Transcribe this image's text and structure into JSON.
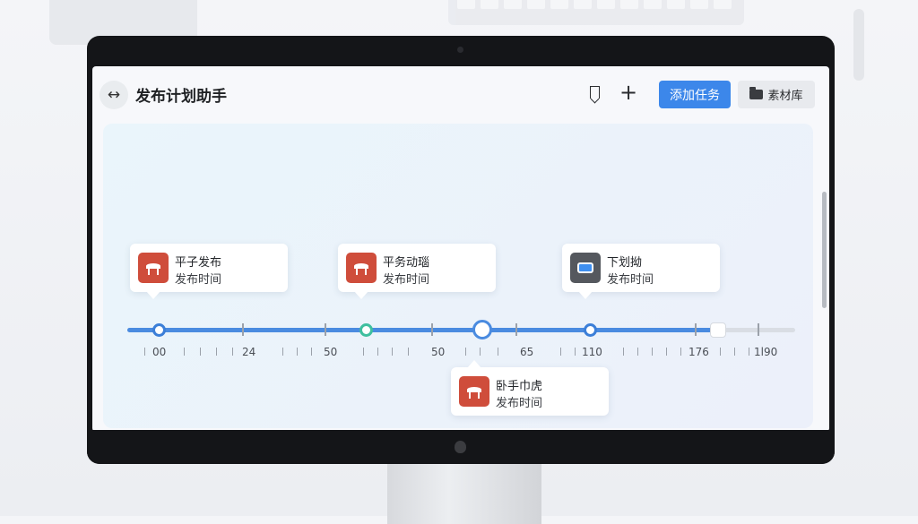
{
  "app": {
    "title": "发布计划助手"
  },
  "header": {
    "add_task_label": "添加任务",
    "library_label": "素材库",
    "plus_label": "+",
    "back_label": "↔"
  },
  "timeline": {
    "tick_labels": [
      "00",
      "24",
      "50",
      "50",
      "65",
      "110",
      "176",
      "1l90"
    ]
  },
  "cards": [
    {
      "title": "平子发布",
      "subtitle": "发布时间",
      "icon": "app-icon-red"
    },
    {
      "title": "平务动瑙",
      "subtitle": "发布时间",
      "icon": "app-icon-red"
    },
    {
      "title": "下划拗",
      "subtitle": "发布时间",
      "icon": "camera-app-icon"
    },
    {
      "title": "卧手巾虎",
      "subtitle": "发布时间",
      "icon": "app-icon-red"
    }
  ],
  "colors": {
    "accent": "#3c87ea",
    "timeline_fill": "#4a8be0",
    "node_green": "#3fbf9f",
    "app_icon_red": "#cf4d3b"
  }
}
